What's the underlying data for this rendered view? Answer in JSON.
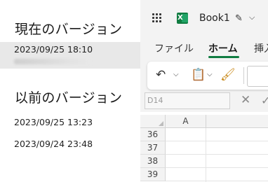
{
  "versions_panel": {
    "current_title": "現在のバージョン",
    "current_timestamp": "2023/09/25 18:10",
    "previous_title": "以前のバージョン",
    "previous_versions": [
      {
        "timestamp": "2023/09/25 13:23"
      },
      {
        "timestamp": "2023/09/24 23:48"
      }
    ]
  },
  "excel": {
    "app_launcher_icon": "waffle-icon",
    "logo_letter": "X",
    "workbook_name": "Book1",
    "rename_icon": "pencil-settings-icon",
    "tabs": [
      {
        "label": "ファイル",
        "active": false
      },
      {
        "label": "ホーム",
        "active": true
      },
      {
        "label": "挿入",
        "active": false
      }
    ],
    "ribbon": {
      "undo_icon": "undo-icon",
      "paste_icon": "clipboard-icon",
      "format_painter_icon": "brush-icon"
    },
    "name_box": "D14",
    "grid": {
      "columns": [
        "A"
      ],
      "rows": [
        "36",
        "37",
        "38",
        "39"
      ]
    }
  },
  "colors": {
    "excel_green": "#107c41",
    "selected_row_bg": "#e8e8e8"
  }
}
